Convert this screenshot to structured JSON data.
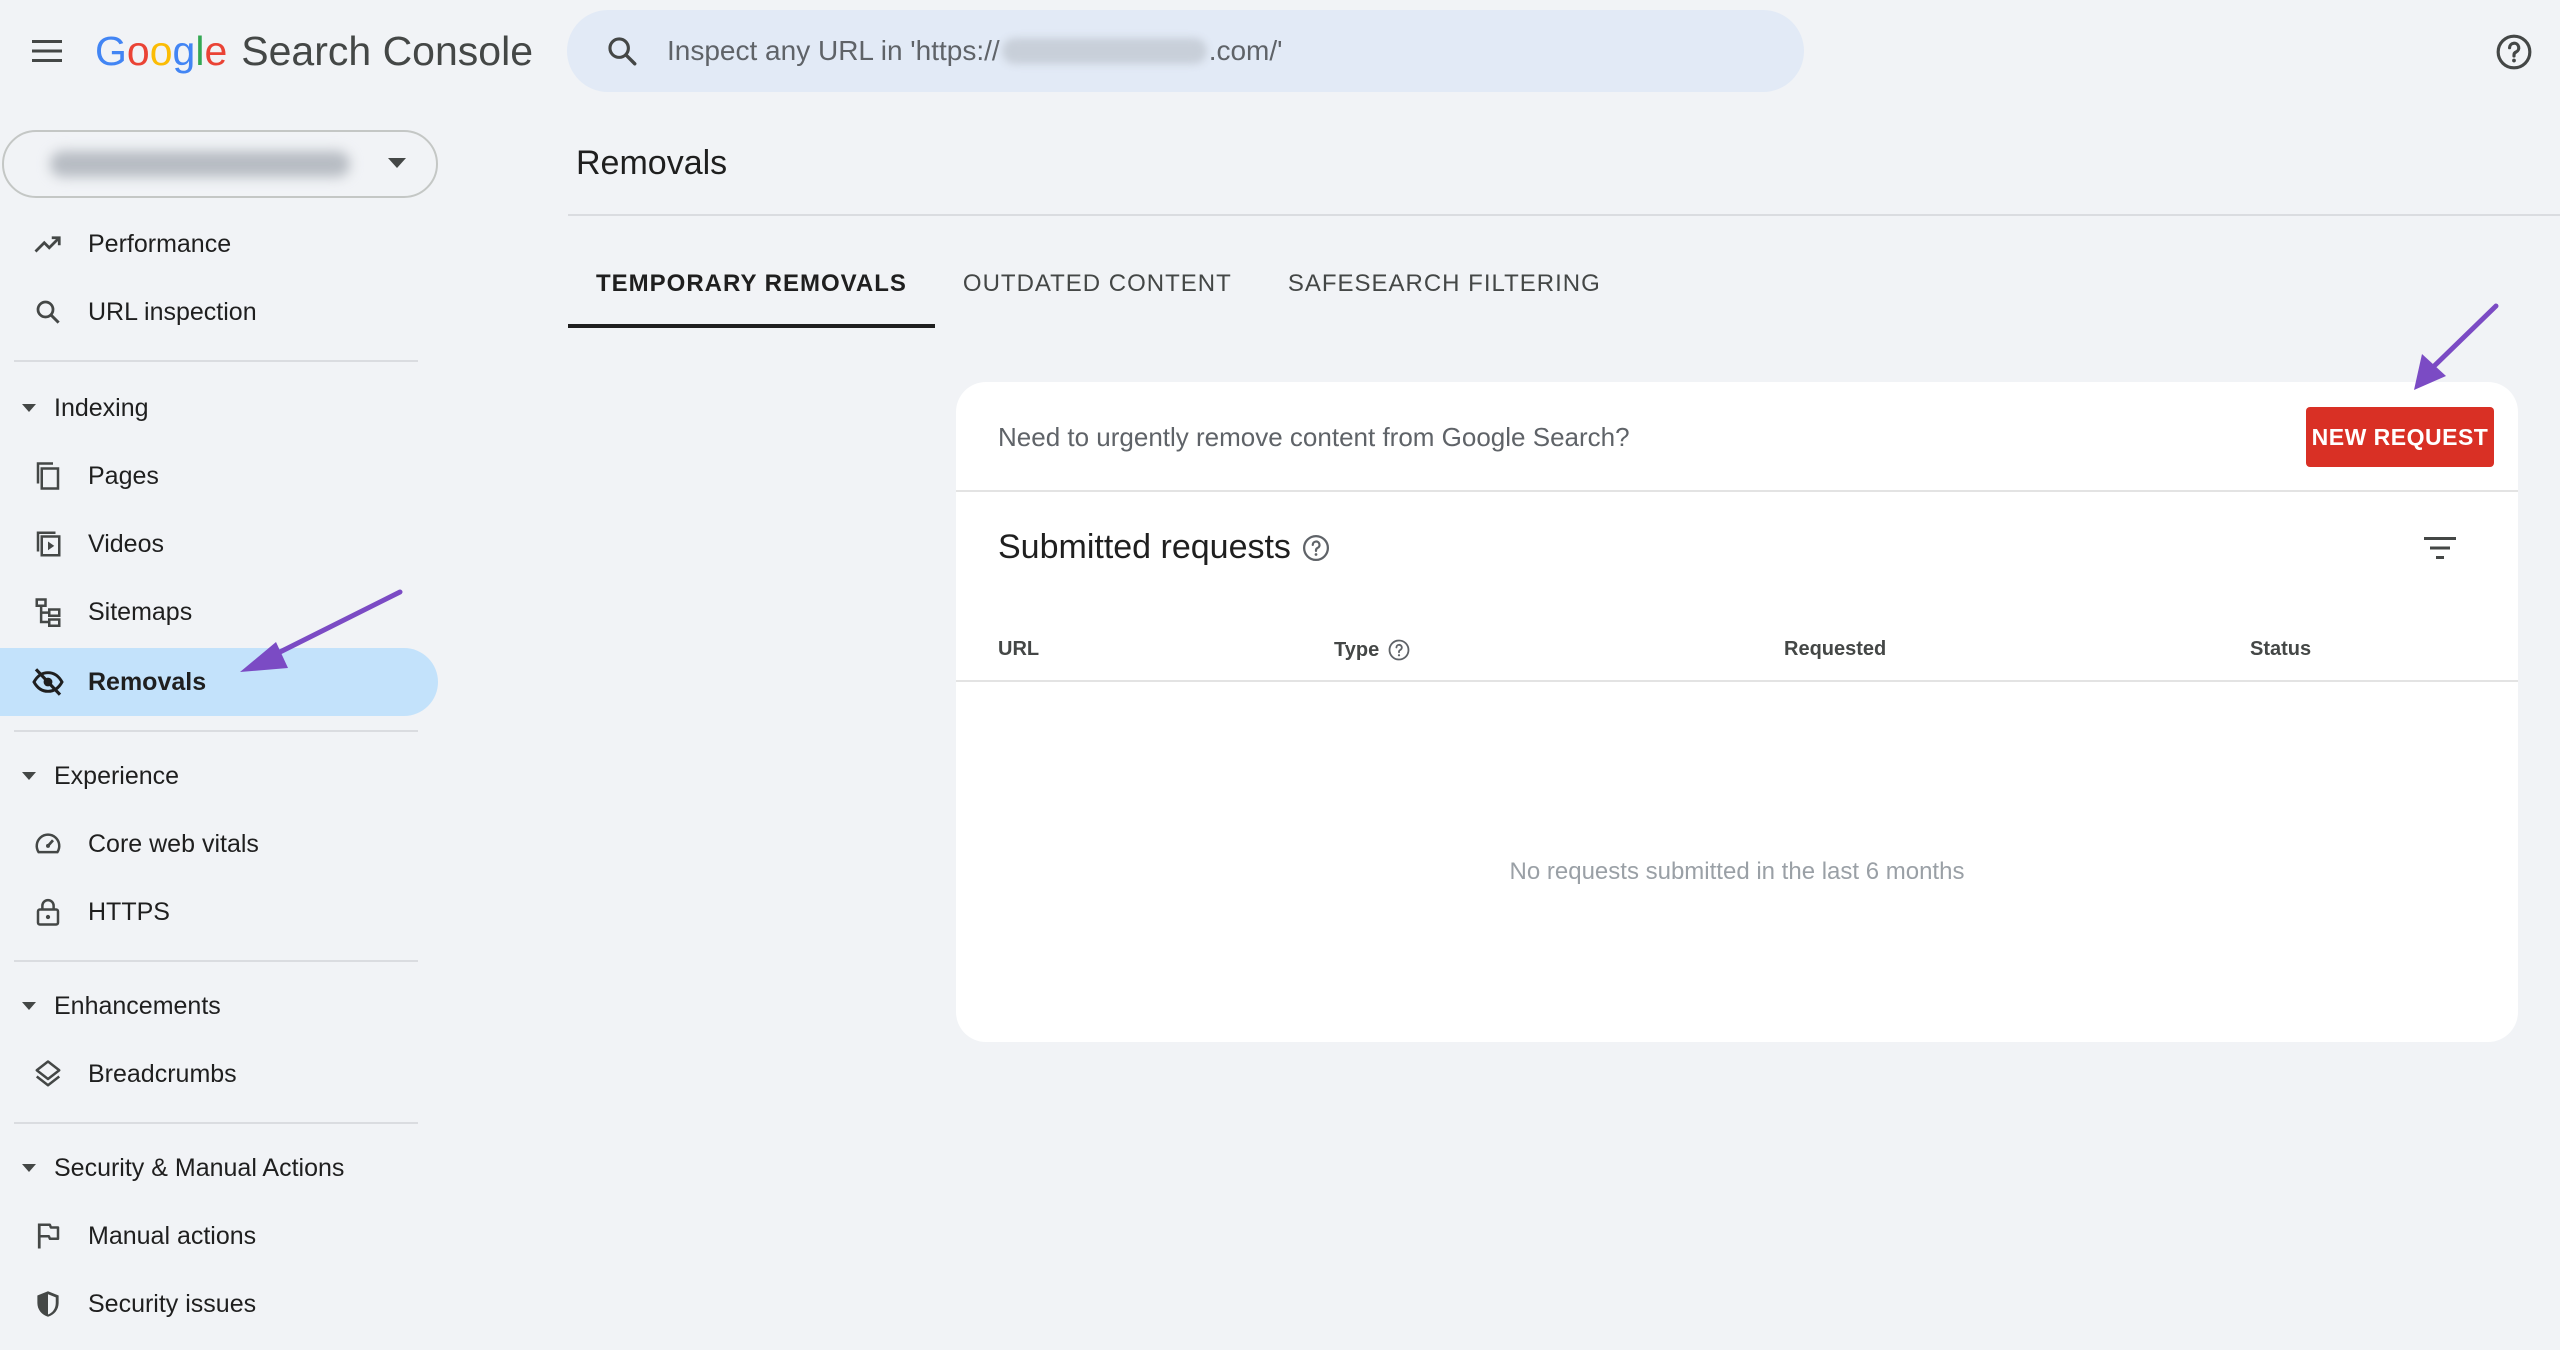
{
  "header": {
    "logo_letters": [
      "G",
      "o",
      "o",
      "g",
      "l",
      "e"
    ],
    "logo_product": "Search Console",
    "search_prefix": "Inspect any URL in 'https://",
    "search_suffix": ".com/'"
  },
  "sidebar": {
    "top_items": [
      {
        "label": "Performance",
        "icon": "trending-up-icon"
      },
      {
        "label": "URL inspection",
        "icon": "search-icon"
      }
    ],
    "sections": [
      {
        "label": "Indexing",
        "items": [
          {
            "label": "Pages",
            "icon": "pages-icon"
          },
          {
            "label": "Videos",
            "icon": "videos-icon"
          },
          {
            "label": "Sitemaps",
            "icon": "sitemap-icon"
          },
          {
            "label": "Removals",
            "icon": "eye-off-icon",
            "active": true
          }
        ]
      },
      {
        "label": "Experience",
        "items": [
          {
            "label": "Core web vitals",
            "icon": "gauge-icon"
          },
          {
            "label": "HTTPS",
            "icon": "lock-icon"
          }
        ]
      },
      {
        "label": "Enhancements",
        "items": [
          {
            "label": "Breadcrumbs",
            "icon": "layers-icon"
          }
        ]
      },
      {
        "label": "Security & Manual Actions",
        "items": [
          {
            "label": "Manual actions",
            "icon": "flag-icon"
          },
          {
            "label": "Security issues",
            "icon": "shield-icon"
          }
        ]
      }
    ]
  },
  "main": {
    "page_title": "Removals",
    "tabs": [
      "TEMPORARY REMOVALS",
      "OUTDATED CONTENT",
      "SAFESEARCH FILTERING"
    ],
    "active_tab": 0,
    "card": {
      "prompt": "Need to urgently remove content from Google Search?",
      "new_request_label": "NEW REQUEST",
      "section_title": "Submitted requests",
      "columns": [
        "URL",
        "Type",
        "Requested",
        "Status"
      ],
      "empty_message": "No requests submitted in the last 6 months"
    }
  },
  "colors": {
    "accent_active": "#c3e2fb",
    "new_request": "#d93025",
    "annotation_arrow": "#7b4bc4",
    "logo": [
      "#4285f4",
      "#ea4335",
      "#fbbc05",
      "#4285f4",
      "#34a853",
      "#ea4335"
    ]
  }
}
